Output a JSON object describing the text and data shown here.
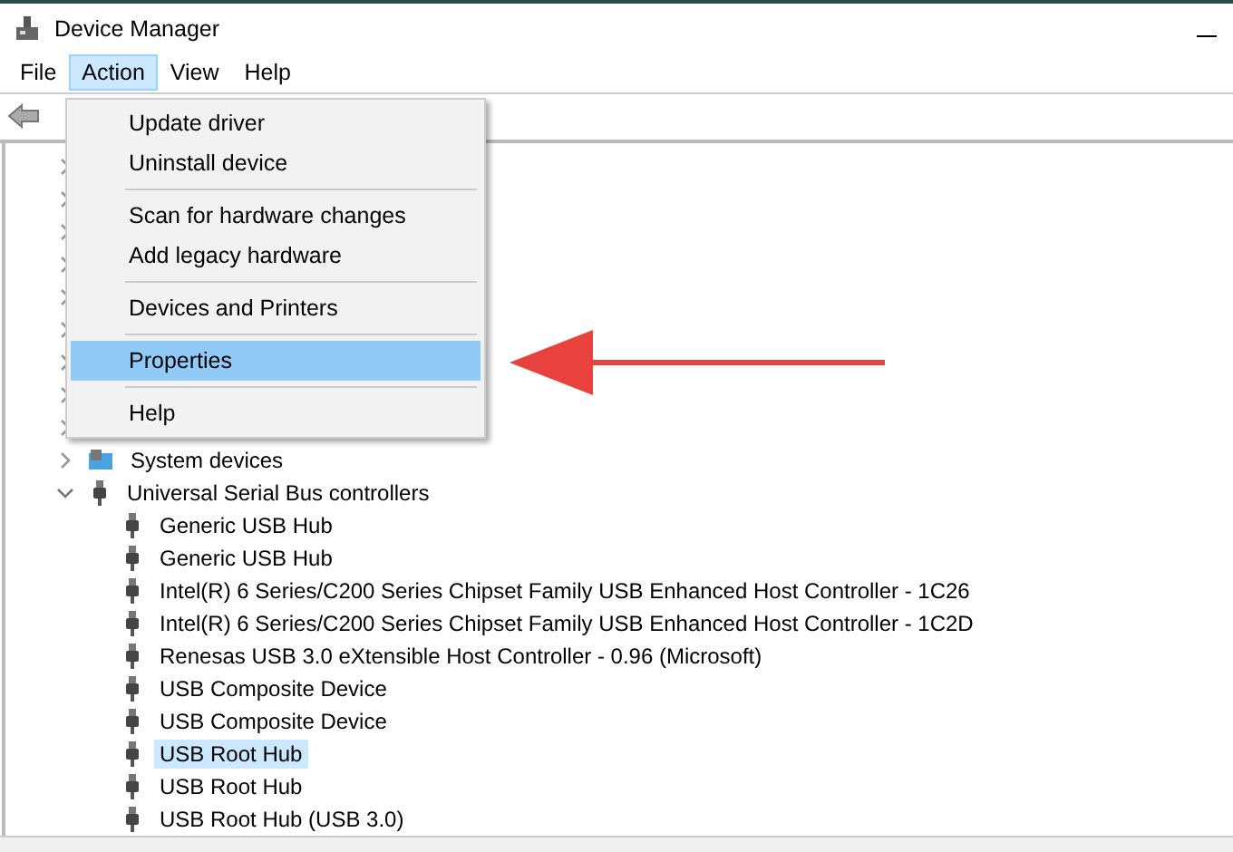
{
  "window": {
    "title": "Device Manager"
  },
  "menu_bar": [
    {
      "label": "File",
      "selected": false
    },
    {
      "label": "Action",
      "selected": true
    },
    {
      "label": "View",
      "selected": false
    },
    {
      "label": "Help",
      "selected": false
    }
  ],
  "action_menu": [
    {
      "kind": "item",
      "label": "Update driver",
      "selected": false
    },
    {
      "kind": "item",
      "label": "Uninstall device",
      "selected": false
    },
    {
      "kind": "separator"
    },
    {
      "kind": "item",
      "label": "Scan for hardware changes",
      "selected": false
    },
    {
      "kind": "item",
      "label": "Add legacy hardware",
      "selected": false
    },
    {
      "kind": "separator"
    },
    {
      "kind": "item",
      "label": "Devices and Printers",
      "selected": false
    },
    {
      "kind": "separator"
    },
    {
      "kind": "item",
      "label": "Properties",
      "selected": true
    },
    {
      "kind": "separator"
    },
    {
      "kind": "item",
      "label": "Help",
      "selected": false
    }
  ],
  "tree": [
    {
      "expanded": false
    },
    {
      "expanded": false
    },
    {
      "expanded": false
    },
    {
      "expanded": false
    },
    {
      "expanded": false
    },
    {
      "expanded": false
    },
    {
      "expanded": false
    },
    {
      "expanded": false
    },
    {
      "expanded": false
    },
    {
      "label": "System devices",
      "expanded": false
    },
    {
      "label": "Universal Serial Bus controllers",
      "expanded": true,
      "children": [
        {
          "label": "Generic USB Hub",
          "selected": false
        },
        {
          "label": "Generic USB Hub",
          "selected": false
        },
        {
          "label": "Intel(R) 6 Series/C200 Series Chipset Family USB Enhanced Host Controller - 1C26",
          "selected": false
        },
        {
          "label": "Intel(R) 6 Series/C200 Series Chipset Family USB Enhanced Host Controller - 1C2D",
          "selected": false
        },
        {
          "label": "Renesas USB 3.0 eXtensible Host Controller - 0.96 (Microsoft)",
          "selected": false
        },
        {
          "label": "USB Composite Device",
          "selected": false
        },
        {
          "label": "USB Composite Device",
          "selected": false
        },
        {
          "label": "USB Root Hub",
          "selected": true
        },
        {
          "label": "USB Root Hub",
          "selected": false
        },
        {
          "label": "USB Root Hub (USB 3.0)",
          "selected": false
        }
      ]
    }
  ]
}
